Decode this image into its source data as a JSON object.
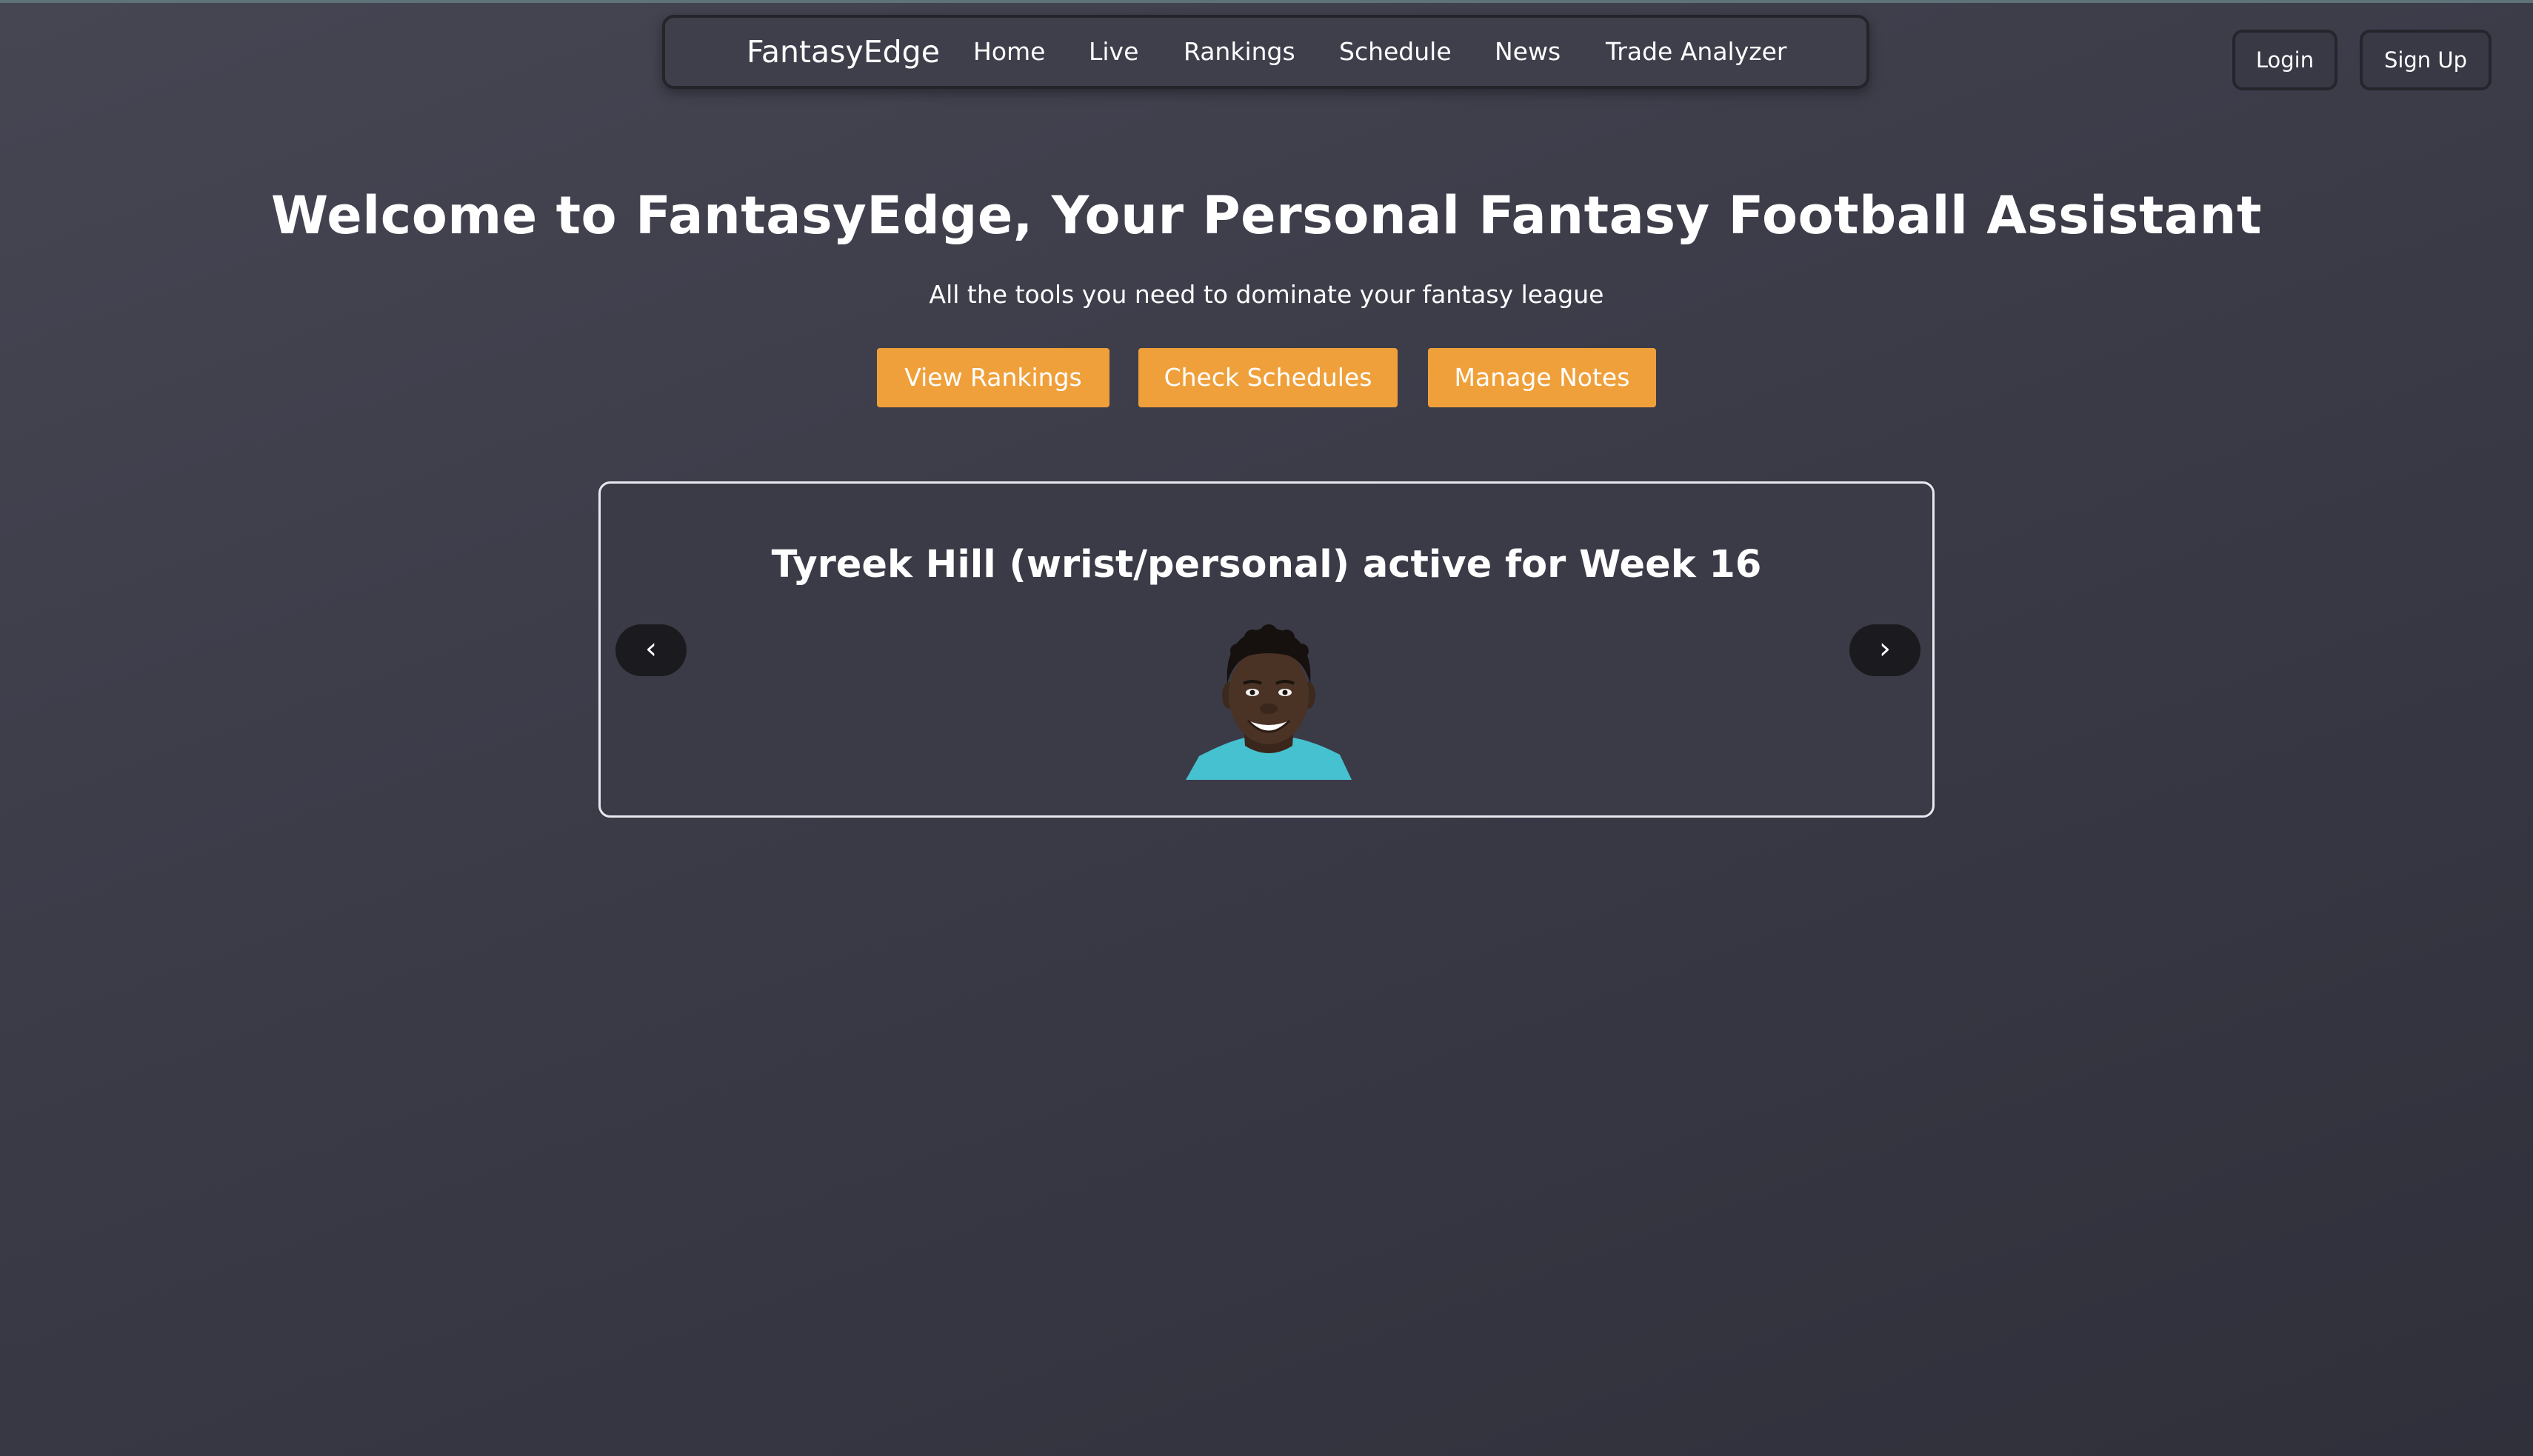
{
  "nav": {
    "brand": "FantasyEdge",
    "links": [
      "Home",
      "Live",
      "Rankings",
      "Schedule",
      "News",
      "Trade Analyzer"
    ]
  },
  "auth": {
    "login": "Login",
    "signup": "Sign Up"
  },
  "hero": {
    "title": "Welcome to FantasyEdge, Your Personal Fantasy Football Assistant",
    "subtitle": "All the tools you need to dominate your fantasy league",
    "buttons": [
      "View Rankings",
      "Check Schedules",
      "Manage Notes"
    ]
  },
  "carousel": {
    "headline": "Tyreek Hill (wrist/personal) active for Week 16",
    "prev_label": "‹",
    "next_label": "›"
  },
  "colors": {
    "accent": "#f0a03a",
    "background": "#3c3c49",
    "arrow_button": "#1b1b1f"
  }
}
